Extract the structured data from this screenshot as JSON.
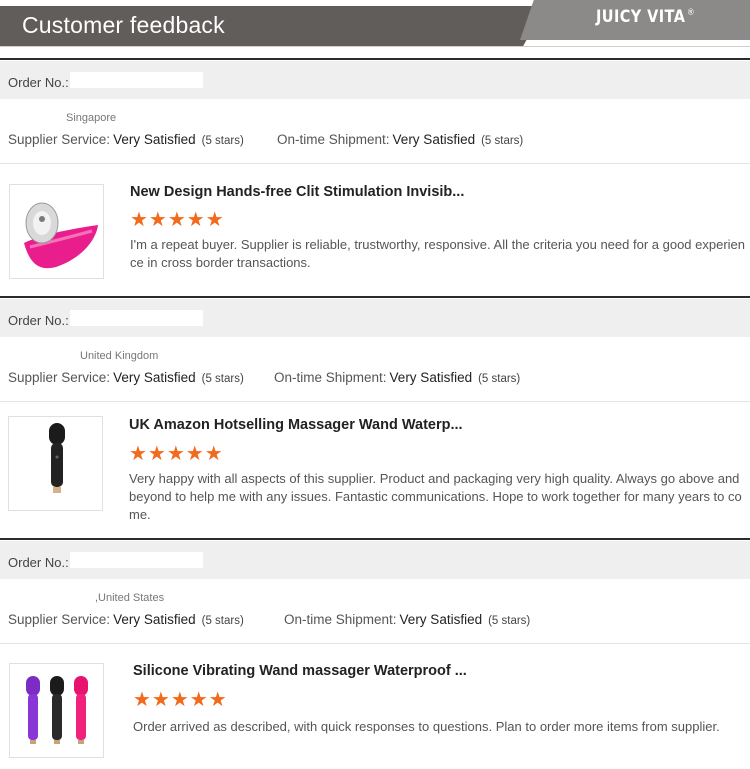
{
  "header": {
    "title": "Customer feedback",
    "logo": "JUICY VITA",
    "logo_mark": "®"
  },
  "feedback": [
    {
      "order_label": "Order No.:",
      "order_value": "",
      "country": "Singapore",
      "supplier_service_label": "Supplier Service:",
      "supplier_service_value": "Very Satisfied",
      "supplier_service_count": "(5 stars)",
      "shipment_label": "On-time Shipment:",
      "shipment_value": "Very Satisfied",
      "shipment_count": "(5 stars)",
      "product_title": "New Design Hands-free Clit Stimulation Invisib...",
      "rating": 5,
      "review": "I'm a repeat buyer. Supplier is reliable, trustworthy, responsive. All the criteria you need for a good experience in cross border transactions.",
      "thumbnail": "pink-vibrator-image"
    },
    {
      "order_label": "Order No.:",
      "order_value": "",
      "country": "United Kingdom",
      "supplier_service_label": "Supplier Service:",
      "supplier_service_value": "Very Satisfied",
      "supplier_service_count": "(5 stars)",
      "shipment_label": "On-time Shipment:",
      "shipment_value": "Very Satisfied",
      "shipment_count": "(5 stars)",
      "product_title": "UK Amazon Hotselling Massager Wand Waterp...",
      "rating": 5,
      "review": "Very happy with all aspects of this supplier. Product and packaging very high quality. Always go above and beyond to help me with any issues. Fantastic communications. Hope to work together for many years to come.",
      "thumbnail": "black-wand-image"
    },
    {
      "order_label": "Order No.:",
      "order_value": "",
      "country": ",United States",
      "supplier_service_label": "Supplier Service:",
      "supplier_service_value": "Very Satisfied",
      "supplier_service_count": "(5 stars)",
      "shipment_label": "On-time Shipment:",
      "shipment_value": "Very Satisfied",
      "shipment_count": "(5 stars)",
      "product_title": "Silicone Vibrating Wand massager Waterproof ...",
      "rating": 5,
      "review": "Order arrived as described, with quick responses to questions.  Plan to order more items from supplier.",
      "thumbnail": "three-wands-image"
    }
  ],
  "colors": {
    "header_dark": "#605d5b",
    "header_light": "#8c8a88",
    "star": "#f26a1b",
    "order_bar": "#efefef"
  }
}
